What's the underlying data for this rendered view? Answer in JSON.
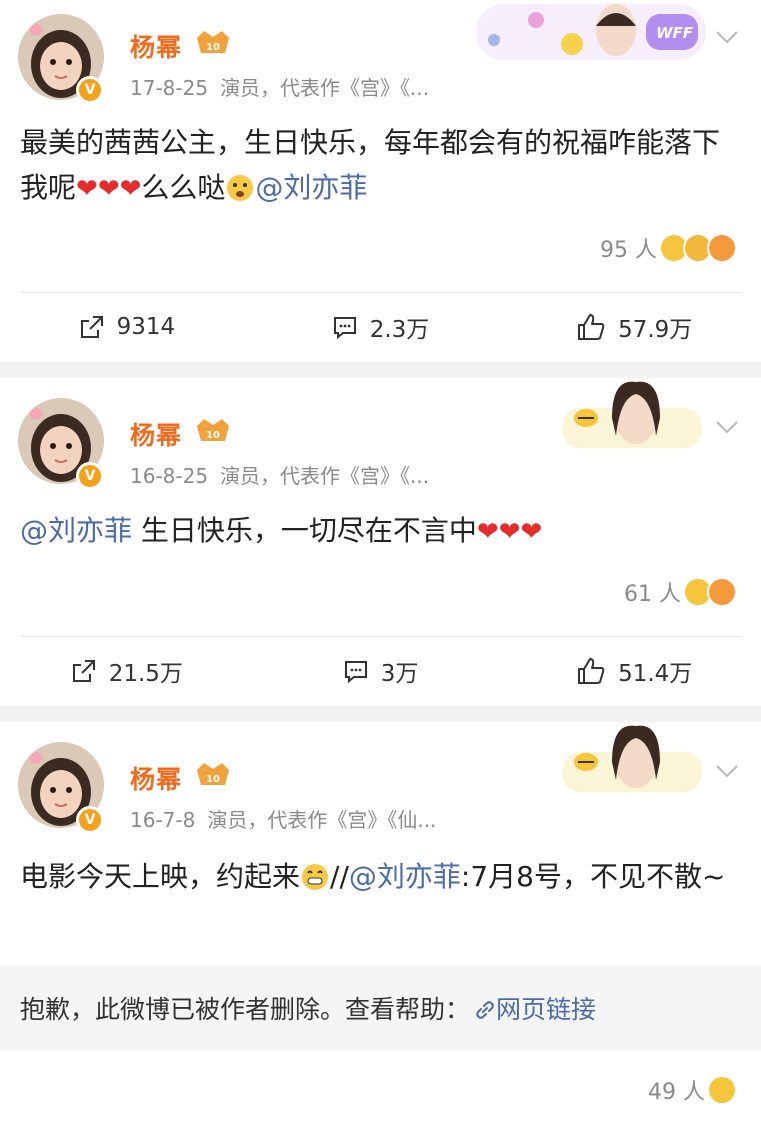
{
  "colors": {
    "name": "#f26a1b",
    "mention": "#4d6ba6",
    "meta": "#8a8a8a",
    "heart": "#e52b2b",
    "badge": "#f3a21a"
  },
  "posts": [
    {
      "author": "杨幂",
      "date": "17-8-25",
      "desc": "演员，代表作《宫》《...",
      "text_before": "最美的茜茜公主，生日快乐，每年都会有的祝福咋能落下我呢",
      "hearts": [
        "❤",
        "❤",
        "❤"
      ],
      "text_after": "么么哒",
      "mention": "@刘亦菲",
      "reaction_count": "95 人",
      "reaction_icons": [
        "laugh-emoji",
        "surprised-emoji",
        "kiss-emoji"
      ],
      "repost_count": "9314",
      "comment_count": "2.3万",
      "like_count": "57.9万",
      "card_decoration": "WFF"
    },
    {
      "author": "杨幂",
      "date": "16-8-25",
      "desc": "演员，代表作《宫》《...",
      "mention": "@刘亦菲",
      "text": " 生日快乐，一切尽在不言中",
      "hearts": [
        "❤",
        "❤",
        "❤"
      ],
      "reaction_count": "61 人",
      "reaction_icons": [
        "laugh-emoji",
        "kiss-emoji"
      ],
      "repost_count": "21.5万",
      "comment_count": "3万",
      "like_count": "51.4万"
    },
    {
      "author": "杨幂",
      "date": "16-7-8",
      "desc": "演员，代表作《宫》《仙...",
      "text_before": "电影今天上映，约起来",
      "text_mid": "//",
      "mention": "@刘亦菲",
      "text_after": ":7月8号，不见不散~",
      "deleted_notice": "抱歉，此微博已被作者删除。查看帮助：",
      "deleted_link": "网页链接",
      "reaction_count": "49 人",
      "reaction_icons": [
        "laugh-emoji"
      ]
    }
  ]
}
